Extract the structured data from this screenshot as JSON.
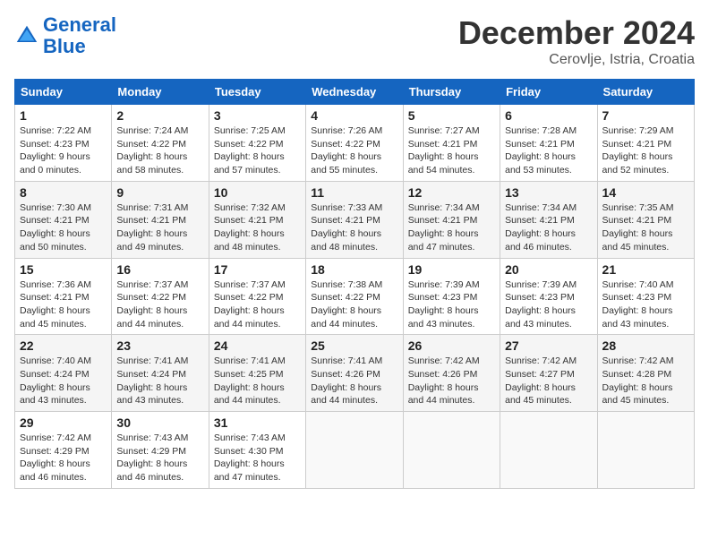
{
  "header": {
    "logo_line1": "General",
    "logo_line2": "Blue",
    "month": "December 2024",
    "location": "Cerovlje, Istria, Croatia"
  },
  "days_of_week": [
    "Sunday",
    "Monday",
    "Tuesday",
    "Wednesday",
    "Thursday",
    "Friday",
    "Saturday"
  ],
  "weeks": [
    [
      {
        "day": "1",
        "info": "Sunrise: 7:22 AM\nSunset: 4:23 PM\nDaylight: 9 hours\nand 0 minutes."
      },
      {
        "day": "2",
        "info": "Sunrise: 7:24 AM\nSunset: 4:22 PM\nDaylight: 8 hours\nand 58 minutes."
      },
      {
        "day": "3",
        "info": "Sunrise: 7:25 AM\nSunset: 4:22 PM\nDaylight: 8 hours\nand 57 minutes."
      },
      {
        "day": "4",
        "info": "Sunrise: 7:26 AM\nSunset: 4:22 PM\nDaylight: 8 hours\nand 55 minutes."
      },
      {
        "day": "5",
        "info": "Sunrise: 7:27 AM\nSunset: 4:21 PM\nDaylight: 8 hours\nand 54 minutes."
      },
      {
        "day": "6",
        "info": "Sunrise: 7:28 AM\nSunset: 4:21 PM\nDaylight: 8 hours\nand 53 minutes."
      },
      {
        "day": "7",
        "info": "Sunrise: 7:29 AM\nSunset: 4:21 PM\nDaylight: 8 hours\nand 52 minutes."
      }
    ],
    [
      {
        "day": "8",
        "info": "Sunrise: 7:30 AM\nSunset: 4:21 PM\nDaylight: 8 hours\nand 50 minutes."
      },
      {
        "day": "9",
        "info": "Sunrise: 7:31 AM\nSunset: 4:21 PM\nDaylight: 8 hours\nand 49 minutes."
      },
      {
        "day": "10",
        "info": "Sunrise: 7:32 AM\nSunset: 4:21 PM\nDaylight: 8 hours\nand 48 minutes."
      },
      {
        "day": "11",
        "info": "Sunrise: 7:33 AM\nSunset: 4:21 PM\nDaylight: 8 hours\nand 48 minutes."
      },
      {
        "day": "12",
        "info": "Sunrise: 7:34 AM\nSunset: 4:21 PM\nDaylight: 8 hours\nand 47 minutes."
      },
      {
        "day": "13",
        "info": "Sunrise: 7:34 AM\nSunset: 4:21 PM\nDaylight: 8 hours\nand 46 minutes."
      },
      {
        "day": "14",
        "info": "Sunrise: 7:35 AM\nSunset: 4:21 PM\nDaylight: 8 hours\nand 45 minutes."
      }
    ],
    [
      {
        "day": "15",
        "info": "Sunrise: 7:36 AM\nSunset: 4:21 PM\nDaylight: 8 hours\nand 45 minutes."
      },
      {
        "day": "16",
        "info": "Sunrise: 7:37 AM\nSunset: 4:22 PM\nDaylight: 8 hours\nand 44 minutes."
      },
      {
        "day": "17",
        "info": "Sunrise: 7:37 AM\nSunset: 4:22 PM\nDaylight: 8 hours\nand 44 minutes."
      },
      {
        "day": "18",
        "info": "Sunrise: 7:38 AM\nSunset: 4:22 PM\nDaylight: 8 hours\nand 44 minutes."
      },
      {
        "day": "19",
        "info": "Sunrise: 7:39 AM\nSunset: 4:23 PM\nDaylight: 8 hours\nand 43 minutes."
      },
      {
        "day": "20",
        "info": "Sunrise: 7:39 AM\nSunset: 4:23 PM\nDaylight: 8 hours\nand 43 minutes."
      },
      {
        "day": "21",
        "info": "Sunrise: 7:40 AM\nSunset: 4:23 PM\nDaylight: 8 hours\nand 43 minutes."
      }
    ],
    [
      {
        "day": "22",
        "info": "Sunrise: 7:40 AM\nSunset: 4:24 PM\nDaylight: 8 hours\nand 43 minutes."
      },
      {
        "day": "23",
        "info": "Sunrise: 7:41 AM\nSunset: 4:24 PM\nDaylight: 8 hours\nand 43 minutes."
      },
      {
        "day": "24",
        "info": "Sunrise: 7:41 AM\nSunset: 4:25 PM\nDaylight: 8 hours\nand 44 minutes."
      },
      {
        "day": "25",
        "info": "Sunrise: 7:41 AM\nSunset: 4:26 PM\nDaylight: 8 hours\nand 44 minutes."
      },
      {
        "day": "26",
        "info": "Sunrise: 7:42 AM\nSunset: 4:26 PM\nDaylight: 8 hours\nand 44 minutes."
      },
      {
        "day": "27",
        "info": "Sunrise: 7:42 AM\nSunset: 4:27 PM\nDaylight: 8 hours\nand 45 minutes."
      },
      {
        "day": "28",
        "info": "Sunrise: 7:42 AM\nSunset: 4:28 PM\nDaylight: 8 hours\nand 45 minutes."
      }
    ],
    [
      {
        "day": "29",
        "info": "Sunrise: 7:42 AM\nSunset: 4:29 PM\nDaylight: 8 hours\nand 46 minutes."
      },
      {
        "day": "30",
        "info": "Sunrise: 7:43 AM\nSunset: 4:29 PM\nDaylight: 8 hours\nand 46 minutes."
      },
      {
        "day": "31",
        "info": "Sunrise: 7:43 AM\nSunset: 4:30 PM\nDaylight: 8 hours\nand 47 minutes."
      },
      {
        "day": "",
        "info": ""
      },
      {
        "day": "",
        "info": ""
      },
      {
        "day": "",
        "info": ""
      },
      {
        "day": "",
        "info": ""
      }
    ]
  ]
}
